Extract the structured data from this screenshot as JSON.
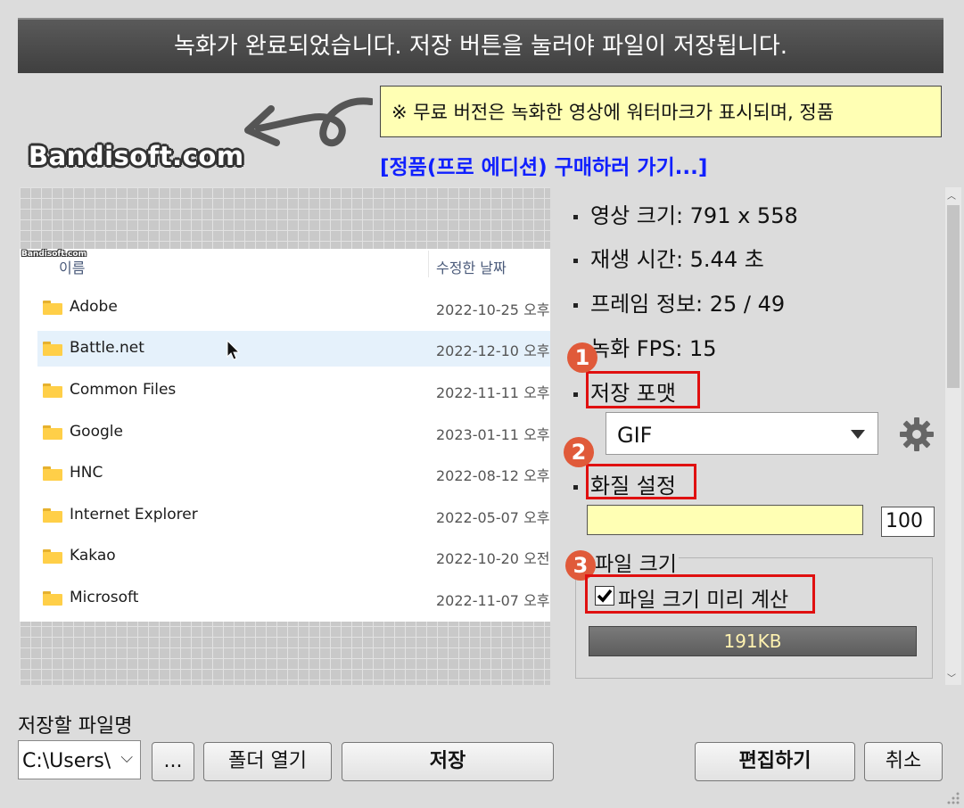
{
  "banner": {
    "text": "녹화가 완료되었습니다. 저장 버튼을 눌러야 파일이 저장됩니다."
  },
  "notice": {
    "text": "※ 무료 버전은 녹화한 영상에 워터마크가 표시되며, 정품"
  },
  "buy_link": {
    "text": "[정품(프로 에디션) 구매하러 가기...]"
  },
  "watermark_logo": {
    "text": "Bandisoft.com"
  },
  "preview": {
    "mini_logo": "Bandisoft.com",
    "header": {
      "name": "이름",
      "date": "수정한 날짜"
    },
    "rows": [
      {
        "name": "Adobe",
        "date": "2022-10-25 오후"
      },
      {
        "name": "Battle.net",
        "date": "2022-12-10 오후"
      },
      {
        "name": "Common Files",
        "date": "2022-11-11 오후"
      },
      {
        "name": "Google",
        "date": "2023-01-11 오후"
      },
      {
        "name": "HNC",
        "date": "2022-08-12 오후"
      },
      {
        "name": "Internet Explorer",
        "date": "2022-05-07 오후"
      },
      {
        "name": "Kakao",
        "date": "2022-10-20 오전"
      },
      {
        "name": "Microsoft",
        "date": "2022-11-07 오후"
      }
    ]
  },
  "info": {
    "video_size": "영상 크기: 791 x 558",
    "play_time": "재생 시간: 5.44 초",
    "frame_info": "프레임 정보: 25 / 49",
    "record_fps": "녹화 FPS: 15",
    "save_format_label": "저장 포맷",
    "format_value": "GIF",
    "quality_label": "화질 설정",
    "quality_value": "100",
    "file_size_group": "파일 크기",
    "precalc_label": "파일 크기 미리 계산",
    "precalc_checked": true,
    "file_size_value": "191KB"
  },
  "badges": [
    "1",
    "2",
    "3"
  ],
  "bottom": {
    "save_filename_label": "저장할 파일명",
    "path_value": "C:\\Users\\",
    "browse_label": "...",
    "open_folder_label": "폴더 열기",
    "save_label": "저장",
    "edit_label": "편집하기",
    "cancel_label": "취소"
  },
  "colors": {
    "banner_bg": "#4a4a4a",
    "notice_bg": "#ffffb4",
    "link": "#1020ff",
    "highlight_box": "#e01010",
    "badge": "#e05a3a"
  }
}
